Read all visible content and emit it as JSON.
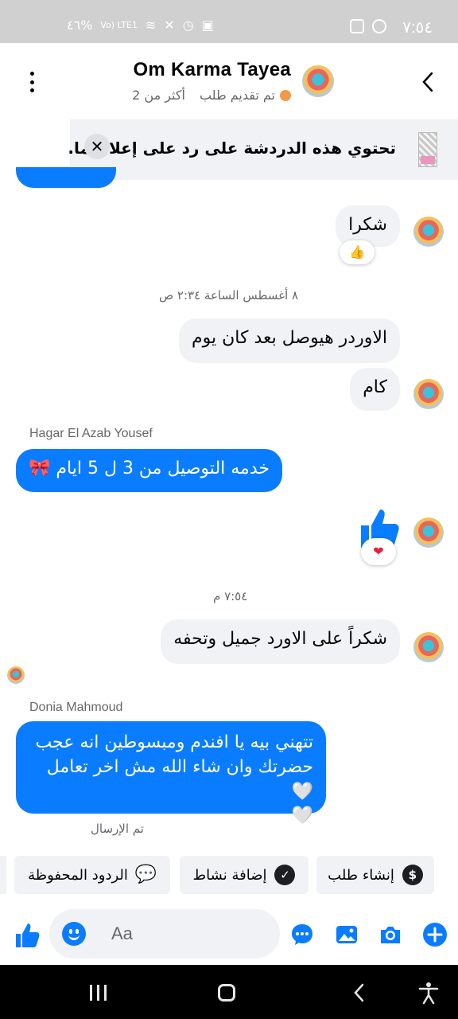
{
  "status_bar": {
    "time": "٧:٥٤",
    "battery": "٤٦%",
    "network": "Vo) LTE1"
  },
  "header": {
    "title": "Om Karma Tayea",
    "subtitle_status": "تم تقديم طلب",
    "subtitle_count": "أكثر من 2"
  },
  "banner": {
    "text": "تحتوي هذه الدردشة على رد على إعلان ما.",
    "close_glyph": "✕"
  },
  "messages": {
    "m1": {
      "text": "شكرا",
      "reaction": "👍"
    },
    "ts1": "٨ أغسطس الساعة ٢:٣٤ ص",
    "m2": {
      "text": "الاوردر هيوصل بعد كان يوم"
    },
    "m3": {
      "text": "كام"
    },
    "sender1": "Hagar El Azab Yousef",
    "m4": {
      "text": "خدمه التوصيل من 3 ل 5 ايام 🎀"
    },
    "m5": {
      "reaction": "❤"
    },
    "ts2": "٧:٥٤ م",
    "m6": {
      "text": "شكراً على الاورد جميل وتحفه"
    },
    "sender2": "Donia Mahmoud",
    "m7": {
      "line1": "تتهني بيه يا افندم ومبسوطين انه عجب",
      "line2": "حضرتك وان شاء الله مش اخر تعامل 🤍",
      "line3": "🤍"
    },
    "sent_status": "تم الإرسال"
  },
  "quick_actions": [
    {
      "label": "إنشاء طلب",
      "icon": "dollar-icon",
      "glyph": "$"
    },
    {
      "label": "إضافة نشاط",
      "icon": "check-icon",
      "glyph": "✓"
    },
    {
      "label": "الردود المحفوظة",
      "icon": "saved-replies-icon",
      "glyph": "💬"
    }
  ],
  "composer": {
    "placeholder": "Aa"
  },
  "colors": {
    "accent": "#0a7cff",
    "bubble_gray": "#f0f2f5",
    "status_bar": "#d0d0d0"
  }
}
